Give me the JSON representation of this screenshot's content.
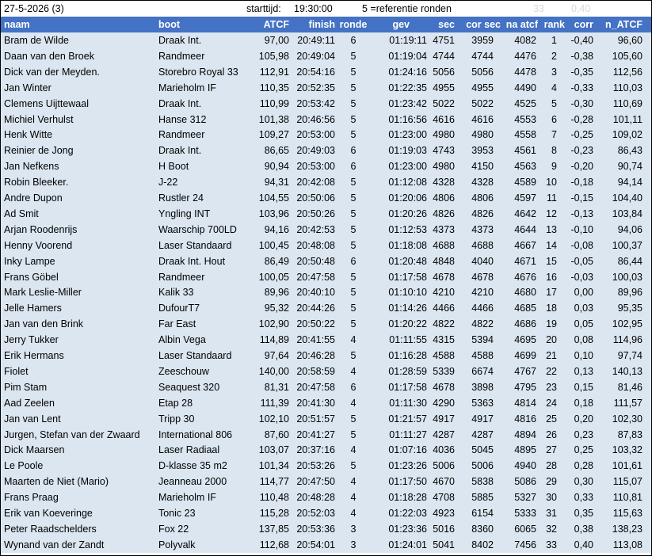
{
  "info": {
    "date": "27-5-2026 (3)",
    "start_label": "starttijd:",
    "start_time": "19:30:00",
    "ref_text": "5 =referentie ronden",
    "faded_value_1": "33",
    "faded_value_2": "0,40"
  },
  "columns": [
    "naam",
    "boot",
    "ATCF",
    "finish",
    "ronde",
    "gev",
    "sec",
    "cor sec",
    "na atcf",
    "rank",
    "corr",
    "n_ATCF"
  ],
  "rows": [
    [
      "Bram de Wilde",
      "Draak Int.",
      "97,00",
      "20:49:11",
      "6",
      "01:19:11",
      "4751",
      "3959",
      "4082",
      "1",
      "-0,40",
      "96,60"
    ],
    [
      "Daan van den Broek",
      "Randmeer",
      "105,98",
      "20:49:04",
      "5",
      "01:19:04",
      "4744",
      "4744",
      "4476",
      "2",
      "-0,38",
      "105,60"
    ],
    [
      "Dick van der Meyden.",
      "Storebro Royal 33",
      "112,91",
      "20:54:16",
      "5",
      "01:24:16",
      "5056",
      "5056",
      "4478",
      "3",
      "-0,35",
      "112,56"
    ],
    [
      "Jan Winter",
      "Marieholm IF",
      "110,35",
      "20:52:35",
      "5",
      "01:22:35",
      "4955",
      "4955",
      "4490",
      "4",
      "-0,33",
      "110,03"
    ],
    [
      "Clemens Uijttewaal",
      "Draak Int.",
      "110,99",
      "20:53:42",
      "5",
      "01:23:42",
      "5022",
      "5022",
      "4525",
      "5",
      "-0,30",
      "110,69"
    ],
    [
      "Michiel Verhulst",
      "Hanse 312",
      "101,38",
      "20:46:56",
      "5",
      "01:16:56",
      "4616",
      "4616",
      "4553",
      "6",
      "-0,28",
      "101,11"
    ],
    [
      "Henk Witte",
      "Randmeer",
      "109,27",
      "20:53:00",
      "5",
      "01:23:00",
      "4980",
      "4980",
      "4558",
      "7",
      "-0,25",
      "109,02"
    ],
    [
      "Reinier de Jong",
      "Draak Int.",
      "86,65",
      "20:49:03",
      "6",
      "01:19:03",
      "4743",
      "3953",
      "4561",
      "8",
      "-0,23",
      "86,43"
    ],
    [
      "Jan Nefkens",
      "H Boot",
      "90,94",
      "20:53:00",
      "6",
      "01:23:00",
      "4980",
      "4150",
      "4563",
      "9",
      "-0,20",
      "90,74"
    ],
    [
      "Robin Bleeker.",
      "J-22",
      "94,31",
      "20:42:08",
      "5",
      "01:12:08",
      "4328",
      "4328",
      "4589",
      "10",
      "-0,18",
      "94,14"
    ],
    [
      "Andre Dupon",
      "Rustler 24",
      "104,55",
      "20:50:06",
      "5",
      "01:20:06",
      "4806",
      "4806",
      "4597",
      "11",
      "-0,15",
      "104,40"
    ],
    [
      "Ad Smit",
      "Yngling INT",
      "103,96",
      "20:50:26",
      "5",
      "01:20:26",
      "4826",
      "4826",
      "4642",
      "12",
      "-0,13",
      "103,84"
    ],
    [
      "Arjan Roodenrijs",
      "Waarschip 700LD",
      "94,16",
      "20:42:53",
      "5",
      "01:12:53",
      "4373",
      "4373",
      "4644",
      "13",
      "-0,10",
      "94,06"
    ],
    [
      "Henny Voorend",
      "Laser Standaard",
      "100,45",
      "20:48:08",
      "5",
      "01:18:08",
      "4688",
      "4688",
      "4667",
      "14",
      "-0,08",
      "100,37"
    ],
    [
      "Inky Lampe",
      "Draak Int. Hout",
      "86,49",
      "20:50:48",
      "6",
      "01:20:48",
      "4848",
      "4040",
      "4671",
      "15",
      "-0,05",
      "86,44"
    ],
    [
      "Frans Göbel",
      "Randmeer",
      "100,05",
      "20:47:58",
      "5",
      "01:17:58",
      "4678",
      "4678",
      "4676",
      "16",
      "-0,03",
      "100,03"
    ],
    [
      "Mark Leslie-Miller",
      "Kalik 33",
      "89,96",
      "20:40:10",
      "5",
      "01:10:10",
      "4210",
      "4210",
      "4680",
      "17",
      "0,00",
      "89,96"
    ],
    [
      "Jelle Hamers",
      "DufourT7",
      "95,32",
      "20:44:26",
      "5",
      "01:14:26",
      "4466",
      "4466",
      "4685",
      "18",
      "0,03",
      "95,35"
    ],
    [
      "Jan van den Brink",
      "Far East",
      "102,90",
      "20:50:22",
      "5",
      "01:20:22",
      "4822",
      "4822",
      "4686",
      "19",
      "0,05",
      "102,95"
    ],
    [
      "Jerry Tukker",
      "Albin Vega",
      "114,89",
      "20:41:55",
      "4",
      "01:11:55",
      "4315",
      "5394",
      "4695",
      "20",
      "0,08",
      "114,96"
    ],
    [
      "Erik Hermans",
      "Laser Standaard",
      "97,64",
      "20:46:28",
      "5",
      "01:16:28",
      "4588",
      "4588",
      "4699",
      "21",
      "0,10",
      "97,74"
    ],
    [
      "Fiolet",
      "Zeeschouw",
      "140,00",
      "20:58:59",
      "4",
      "01:28:59",
      "5339",
      "6674",
      "4767",
      "22",
      "0,13",
      "140,13"
    ],
    [
      "Pim Stam",
      "Seaquest 320",
      "81,31",
      "20:47:58",
      "6",
      "01:17:58",
      "4678",
      "3898",
      "4795",
      "23",
      "0,15",
      "81,46"
    ],
    [
      "Aad Zeelen",
      "Etap 28",
      "111,39",
      "20:41:30",
      "4",
      "01:11:30",
      "4290",
      "5363",
      "4814",
      "24",
      "0,18",
      "111,57"
    ],
    [
      "Jan van Lent",
      "Tripp 30",
      "102,10",
      "20:51:57",
      "5",
      "01:21:57",
      "4917",
      "4917",
      "4816",
      "25",
      "0,20",
      "102,30"
    ],
    [
      "Jurgen, Stefan van der Zwaard",
      "International 806",
      "87,60",
      "20:41:27",
      "5",
      "01:11:27",
      "4287",
      "4287",
      "4894",
      "26",
      "0,23",
      "87,83"
    ],
    [
      "Dick Maarsen",
      "Laser Radiaal",
      "103,07",
      "20:37:16",
      "4",
      "01:07:16",
      "4036",
      "5045",
      "4895",
      "27",
      "0,25",
      "103,32"
    ],
    [
      "Le Poole",
      "D-klasse 35 m2",
      "101,34",
      "20:53:26",
      "5",
      "01:23:26",
      "5006",
      "5006",
      "4940",
      "28",
      "0,28",
      "101,61"
    ],
    [
      "Maarten de Niet (Mario)",
      "Jeanneau 2000",
      "114,77",
      "20:47:50",
      "4",
      "01:17:50",
      "4670",
      "5838",
      "5086",
      "29",
      "0,30",
      "115,07"
    ],
    [
      "Frans Praag",
      "Marieholm IF",
      "110,48",
      "20:48:28",
      "4",
      "01:18:28",
      "4708",
      "5885",
      "5327",
      "30",
      "0,33",
      "110,81"
    ],
    [
      "Erik van Koeveringe",
      "Tonic 23",
      "115,28",
      "20:52:03",
      "4",
      "01:22:03",
      "4923",
      "6154",
      "5333",
      "31",
      "0,35",
      "115,63"
    ],
    [
      "Peter Raadschelders",
      "Fox 22",
      "137,85",
      "20:53:36",
      "3",
      "01:23:36",
      "5016",
      "8360",
      "6065",
      "32",
      "0,38",
      "138,23"
    ],
    [
      "Wynand van der Zandt",
      "Polyvalk",
      "112,68",
      "20:54:01",
      "3",
      "01:24:01",
      "5041",
      "8402",
      "7456",
      "33",
      "0,40",
      "113,08"
    ]
  ]
}
